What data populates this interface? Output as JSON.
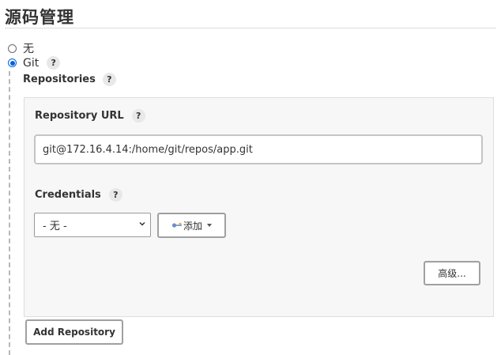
{
  "section": {
    "title": "源码管理"
  },
  "scm_options": {
    "none_label": "无",
    "git_label": "Git",
    "help_glyph": "?",
    "selected": "Git"
  },
  "git": {
    "repositories_label": "Repositories",
    "repo_url_label": "Repository URL",
    "repo_url_value": "git@172.16.4.14:/home/git/repos/app.git",
    "credentials_label": "Credentials",
    "credentials_selected": "- 无 -",
    "add_button_label": "添加",
    "advanced_button_label": "高级...",
    "add_repository_button_label": "Add Repository"
  },
  "colors": {
    "radio_checked": "#0060df",
    "panel_bg": "#f7f7f7",
    "help_bg": "#e8e8e8"
  },
  "icons": {
    "key": "key-icon",
    "caret": "caret-down-icon",
    "select_chevron": "chevron-down-icon",
    "help": "help-icon"
  }
}
